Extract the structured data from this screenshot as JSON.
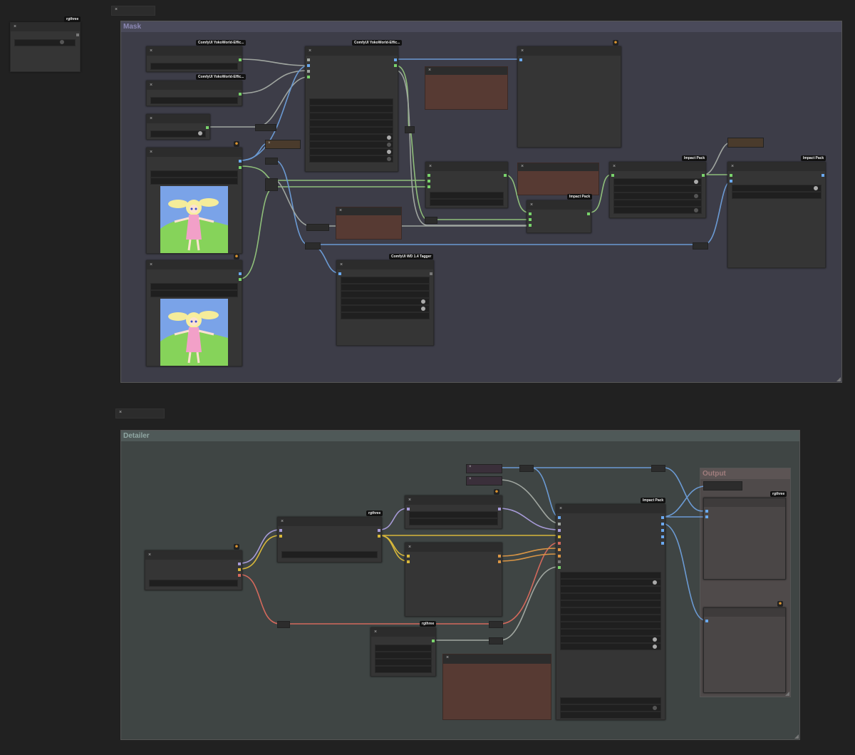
{
  "canvas": {
    "background": "#212121"
  },
  "groups": {
    "mask": {
      "title": "Mask",
      "color": "#3d3d48",
      "title_color": "#8c88b4"
    },
    "detailer": {
      "title": "Detailer",
      "color": "#3f4544",
      "title_color": "#90a7a3"
    },
    "output": {
      "title": "Output",
      "color": "#4f4a4a",
      "title_color": "#a07d7d"
    }
  },
  "badges": {
    "rgthree_top": "rgthree",
    "yoko_1": "ComfyUI YokoWorld-Effic...",
    "yoko_2": "ComfyUI YokoWorld-Effic...",
    "yoko_3": "ComfyUI YokoWorld-Effic...",
    "impact_1": "Impact Pack",
    "impact_2": "Impact Pack",
    "impact_3": "Impact Pack",
    "wd_tagger": "ComfyUI WD 1.4 Tagger",
    "rgthree_d1": "rgthree",
    "rgthree_d2": "rgthree",
    "impact_d": "Impact Pack",
    "rgthree_out": "rgthree"
  },
  "close_glyph": "×",
  "emoji_glyph": "☻",
  "colors": {
    "wire_gray": "#a0a6a0",
    "wire_blue": "#6b9ad3",
    "wire_green": "#8fbf7a",
    "wire_purple": "#a79bd8",
    "wire_yellow": "#d7b73a",
    "wire_orange": "#d99545",
    "wire_red": "#d4695c",
    "note": "#573a33",
    "port_green": "#79d36b",
    "port_blue": "#6aa9f0"
  },
  "icons": [
    "close-icon",
    "emoji-icon",
    "resize-handle-icon"
  ]
}
